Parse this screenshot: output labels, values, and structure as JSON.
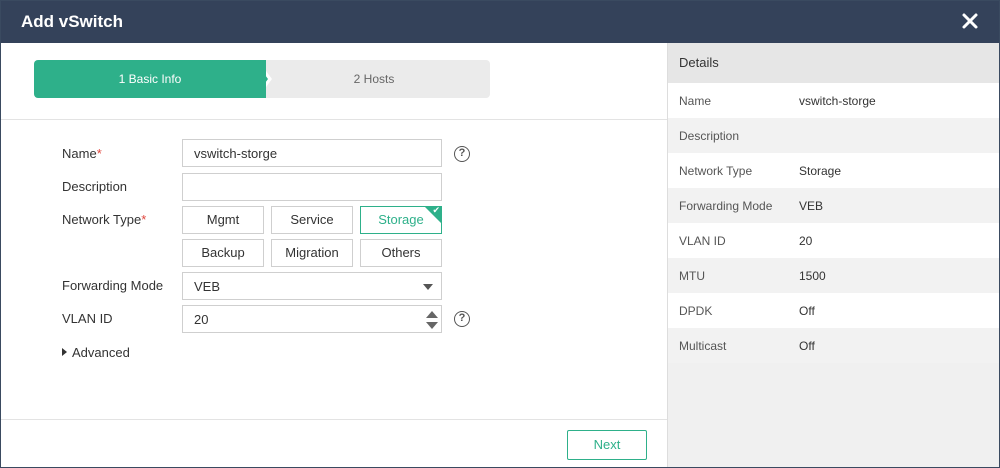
{
  "dialog": {
    "title": "Add vSwitch"
  },
  "stepper": {
    "step1": "1 Basic Info",
    "step2": "2 Hosts"
  },
  "form": {
    "name_label": "Name",
    "name_value": "vswitch-storge",
    "description_label": "Description",
    "description_value": "",
    "network_type_label": "Network Type",
    "network_types": [
      "Mgmt",
      "Service",
      "Storage",
      "Backup",
      "Migration",
      "Others"
    ],
    "network_type_selected": "Storage",
    "forwarding_mode_label": "Forwarding Mode",
    "forwarding_mode_value": "VEB",
    "vlan_id_label": "VLAN ID",
    "vlan_id_value": "20",
    "required_mark": "*",
    "help_glyph": "?",
    "advanced_label": "Advanced"
  },
  "footer": {
    "next_label": "Next"
  },
  "details": {
    "title": "Details",
    "rows": [
      {
        "key": "Name",
        "value": "vswitch-storge"
      },
      {
        "key": "Description",
        "value": ""
      },
      {
        "key": "Network Type",
        "value": "Storage"
      },
      {
        "key": "Forwarding Mode",
        "value": "VEB"
      },
      {
        "key": "VLAN ID",
        "value": "20"
      },
      {
        "key": "MTU",
        "value": "1500"
      },
      {
        "key": "DPDK",
        "value": "Off"
      },
      {
        "key": "Multicast",
        "value": "Off"
      }
    ]
  },
  "colors": {
    "titlebar": "#34425a",
    "accent": "#2eb08a",
    "required": "#e0463d"
  },
  "icons": {
    "close": "close-icon",
    "help": "help-icon",
    "check": "check-icon",
    "dropdown": "chevron-down-icon",
    "caret": "caret-right-icon"
  }
}
